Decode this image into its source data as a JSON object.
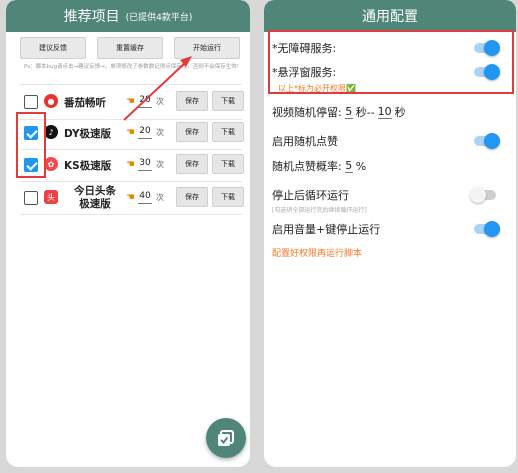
{
  "left_panel": {
    "title": "推荐项目",
    "subtitle": "(已提供4款平台)",
    "buttons": [
      "建议反馈",
      "重置缓存",
      "开始运行"
    ],
    "ps": "Ps：脚本bug请点击→建议反馈→，单项修改了参数数记得点保存按，否则不会保存生效!",
    "rows": [
      {
        "name": "番茄畅听",
        "checked": false,
        "value": "20",
        "unit": "次",
        "icon": "fanqie-icon"
      },
      {
        "name": "DY极速版",
        "checked": true,
        "value": "20",
        "unit": "次",
        "icon": "douyin-icon"
      },
      {
        "name": "KS极速版",
        "checked": true,
        "value": "30",
        "unit": "次",
        "icon": "kuaishou-icon"
      },
      {
        "name_line1": "今日头条",
        "name_line2": "极速版",
        "checked": false,
        "value": "40",
        "unit": "次",
        "icon": "toutiao-icon"
      }
    ],
    "save_label": "保存",
    "download_label": "下载"
  },
  "right_panel": {
    "title": "通用配置",
    "accessibility_label": "*无障碍服务:",
    "floating_label": "*悬浮窗服务:",
    "required_note": "以上*标为必开权限✅",
    "video_pause_label": "视频随机停留:",
    "video_pause_min": "5",
    "video_pause_sep": "秒--",
    "video_pause_max": "10",
    "video_pause_unit": "秒",
    "random_like_label": "启用随机点赞",
    "like_prob_label": "随机点赞概率:",
    "like_prob_value": "5",
    "like_prob_unit": "%",
    "stop_loop_label": "停止后循环运行",
    "stop_loop_note": "[勾选项全部运行完后继续循环运行]",
    "volume_stop_label": "启用音量+键停止运行",
    "config_link": "配置好权限再运行脚本",
    "toggles": {
      "accessibility": true,
      "floating": true,
      "random_like": true,
      "stop_loop": false,
      "volume_stop": true
    }
  },
  "colors": {
    "header": "#4f8677",
    "accent": "#2196f3",
    "highlight": "#e23b3b",
    "link": "#f07a2a"
  }
}
